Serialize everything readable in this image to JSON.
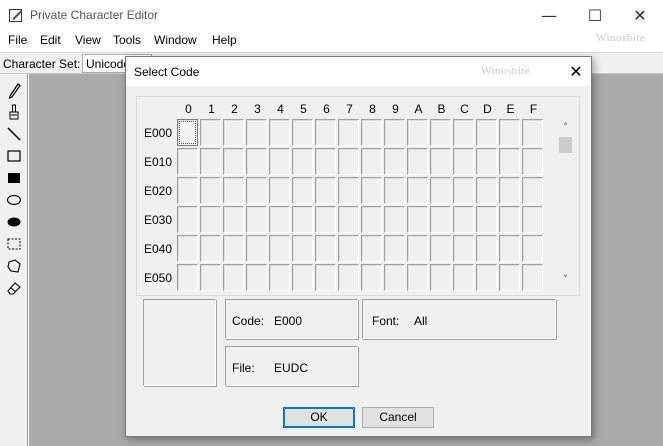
{
  "window": {
    "title": "Private Character Editor",
    "watermark": "Winosbite",
    "controls": {
      "minimize": "—",
      "maximize": "☐",
      "close": "✕"
    }
  },
  "menu": [
    "File",
    "Edit",
    "View",
    "Tools",
    "Window",
    "Help"
  ],
  "charset": {
    "label": "Character Set:",
    "value": "Unicode"
  },
  "tools": [
    "pencil-icon",
    "brush-icon",
    "line-icon",
    "hollow-rectangle-icon",
    "filled-rectangle-icon",
    "hollow-ellipse-icon",
    "filled-ellipse-icon",
    "rectangular-selection-icon",
    "freeform-selection-icon",
    "eraser-icon"
  ],
  "dialog": {
    "title": "Select Code",
    "watermark": "Winosbite",
    "close": "✕",
    "columns": [
      "0",
      "1",
      "2",
      "3",
      "4",
      "5",
      "6",
      "7",
      "8",
      "9",
      "A",
      "B",
      "C",
      "D",
      "E",
      "F"
    ],
    "rows": [
      "E000",
      "E010",
      "E020",
      "E030",
      "E040",
      "E050"
    ],
    "selected_code": "E000",
    "scroll": {
      "up": "˄",
      "down": "˅"
    },
    "code": {
      "label": "Code:",
      "value": "E000"
    },
    "font": {
      "label": "Font:",
      "value": "All"
    },
    "file": {
      "label": "File:",
      "value": "EUDC"
    },
    "ok_label": "OK",
    "cancel_label": "Cancel"
  }
}
